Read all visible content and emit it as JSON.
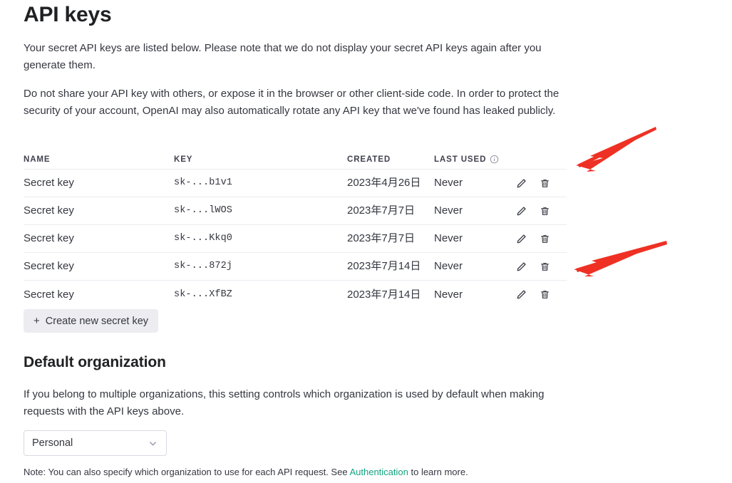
{
  "page": {
    "title": "API keys",
    "intro_paragraph_1": "Your secret API keys are listed below. Please note that we do not display your secret API keys again after you generate them.",
    "intro_paragraph_2": "Do not share your API key with others, or expose it in the browser or other client-side code. In order to protect the security of your account, OpenAI may also automatically rotate any API key that we've found has leaked publicly."
  },
  "table": {
    "headers": {
      "name": "NAME",
      "key": "KEY",
      "created": "CREATED",
      "last_used": "LAST USED"
    },
    "rows": [
      {
        "name": "Secret key",
        "key": "sk-...b1v1",
        "created": "2023年4月26日",
        "last_used": "Never"
      },
      {
        "name": "Secret key",
        "key": "sk-...lWOS",
        "created": "2023年7月7日",
        "last_used": "Never"
      },
      {
        "name": "Secret key",
        "key": "sk-...Kkq0",
        "created": "2023年7月7日",
        "last_used": "Never"
      },
      {
        "name": "Secret key",
        "key": "sk-...872j",
        "created": "2023年7月14日",
        "last_used": "Never"
      },
      {
        "name": "Secret key",
        "key": "sk-...XfBZ",
        "created": "2023年7月14日",
        "last_used": "Never"
      }
    ]
  },
  "create_button": {
    "plus": "+",
    "label": "Create new secret key"
  },
  "organization": {
    "section_title": "Default organization",
    "description": "If you belong to multiple organizations, this setting controls which organization is used by default when making requests with the API keys above.",
    "select_value": "Personal",
    "note_prefix": "Note: You can also specify which organization to use for each API request. See ",
    "note_link": "Authentication",
    "note_suffix": " to learn more."
  },
  "colors": {
    "link": "#10a37f",
    "annotation_arrow": "#ee3124",
    "border": "#ececf1",
    "button_bg": "#ececf1"
  },
  "annotations": [
    {
      "name": "arrow-to-last-used-header"
    },
    {
      "name": "arrow-to-delete-icon-row-4"
    }
  ]
}
